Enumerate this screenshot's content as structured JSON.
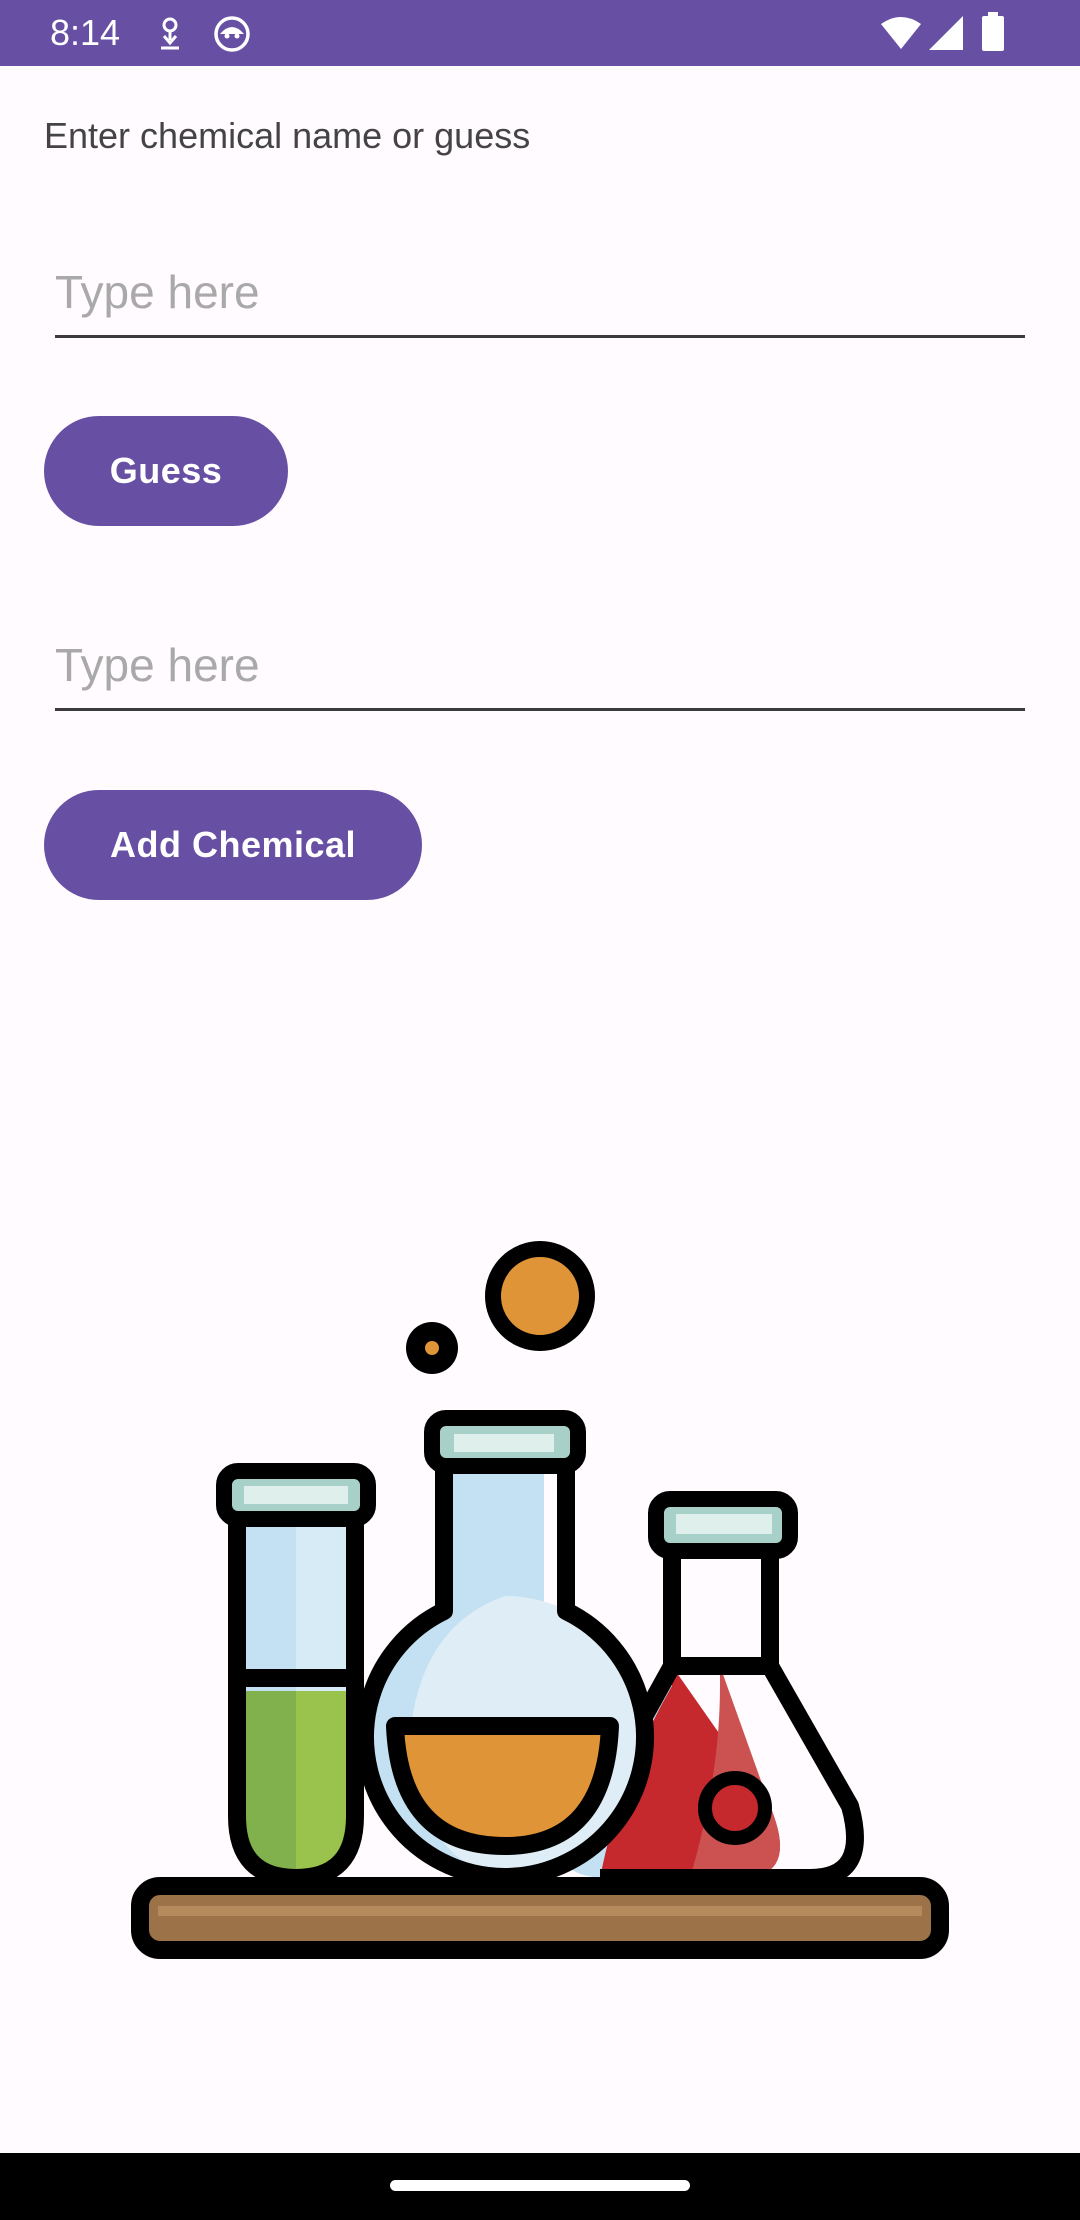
{
  "status_bar": {
    "time": "8:14",
    "icons": [
      "download-icon",
      "android-face-icon",
      "wifi-icon",
      "cellular-signal-icon",
      "battery-icon"
    ],
    "background_color": "#6750a4"
  },
  "main": {
    "prompt_label": "Enter chemical name or guess",
    "guess_input": {
      "value": "",
      "placeholder": "Type here"
    },
    "guess_button_label": "Guess",
    "chemical_input": {
      "value": "",
      "placeholder": "Type here"
    },
    "add_button_label": "Add Chemical",
    "illustration": "chemistry-lab-glassware-icon"
  },
  "colors": {
    "accent": "#6750a4",
    "background": "#fffbfe"
  }
}
